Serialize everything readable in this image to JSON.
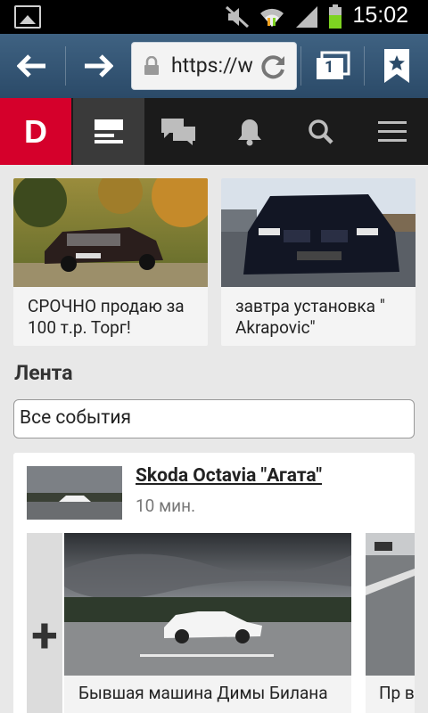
{
  "status_bar": {
    "time": "15:02",
    "battery_color": "#7ed321"
  },
  "browser": {
    "url": "https://w",
    "tab_count": "1"
  },
  "site_nav": {
    "logo": "D",
    "items": [
      {
        "icon": "feed-icon"
      },
      {
        "icon": "messages-icon"
      },
      {
        "icon": "bell-icon"
      },
      {
        "icon": "search-icon"
      },
      {
        "icon": "menu-icon"
      }
    ],
    "accent": "#d5002b"
  },
  "promos": [
    {
      "caption": "СРОЧНО продаю за 100 т.р. Торг!"
    },
    {
      "caption": "завтра установка \" Akrapovic\""
    }
  ],
  "feed": {
    "title": "Лента",
    "filter_value": "Все события"
  },
  "post": {
    "title": "Skoda Octavia \"Агата\"",
    "time": "10 мин.",
    "add_symbol": "+",
    "gallery": [
      {
        "caption": "Бывшая машина Димы Билана"
      },
      {
        "caption": "Пр вы"
      }
    ]
  }
}
